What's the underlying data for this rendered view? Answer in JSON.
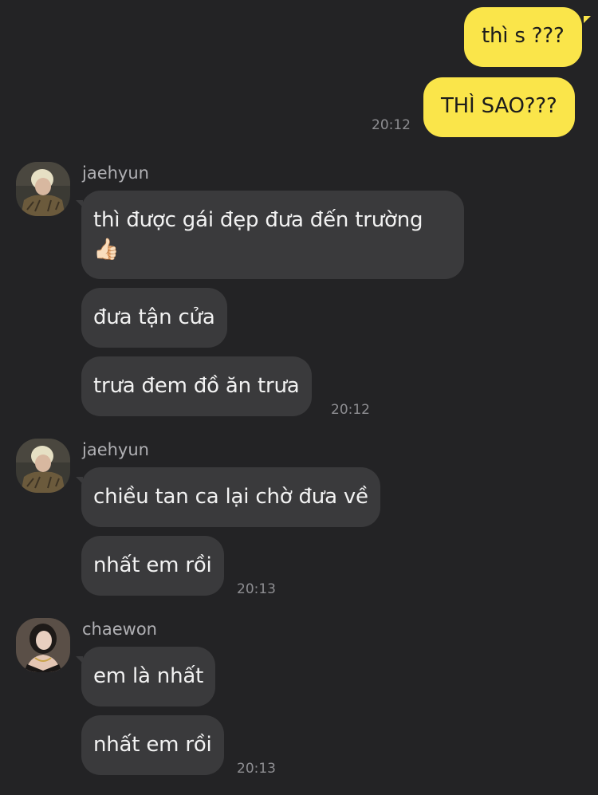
{
  "colors": {
    "background": "#232325",
    "outgoing_bubble": "#fae54a",
    "incoming_bubble": "#3a3a3c",
    "timestamp": "#8e8e92",
    "sender_name": "#b0b0b4"
  },
  "outgoing": {
    "msg1": "thì s ???",
    "msg2": "THÌ SAO???",
    "time": "20:12"
  },
  "group1": {
    "sender": "jaehyun",
    "avatar_icon": "profile-photo",
    "msg1_line1": "thì được gái đẹp đưa đến trường",
    "msg1_emoji": "👍🏻",
    "msg2": "đưa tận cửa",
    "msg3": "trưa đem đồ ăn trưa",
    "time": "20:12"
  },
  "group2": {
    "sender": "jaehyun",
    "avatar_icon": "profile-photo",
    "msg1": "chiều tan ca lại chờ đưa về",
    "msg2": "nhất em rồi",
    "time": "20:13"
  },
  "group3": {
    "sender": "chaewon",
    "avatar_icon": "profile-photo",
    "msg1": "em là nhất",
    "msg2": "nhất em rồi",
    "time": "20:13"
  }
}
